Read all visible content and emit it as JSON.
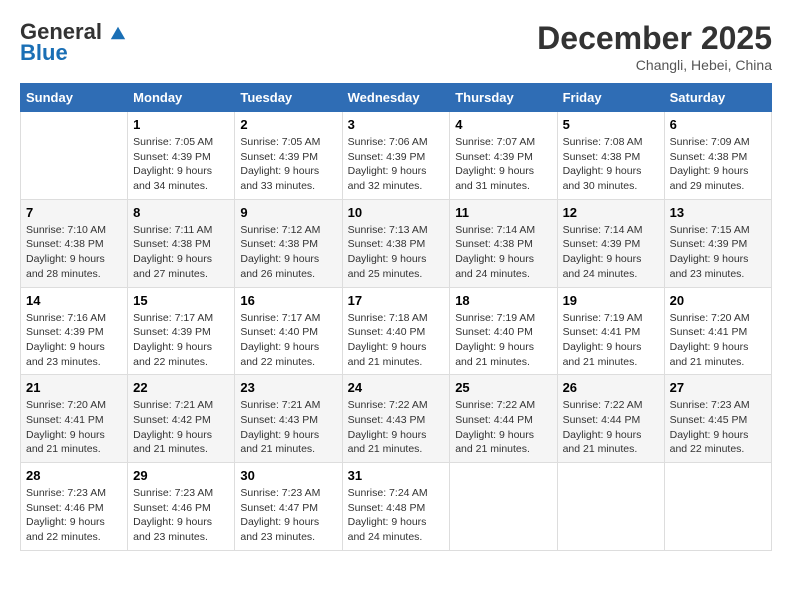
{
  "header": {
    "logo_line1": "General",
    "logo_line2": "Blue",
    "month": "December 2025",
    "location": "Changli, Hebei, China"
  },
  "columns": [
    "Sunday",
    "Monday",
    "Tuesday",
    "Wednesday",
    "Thursday",
    "Friday",
    "Saturday"
  ],
  "weeks": [
    [
      {
        "day": "",
        "info": ""
      },
      {
        "day": "1",
        "info": "Sunrise: 7:05 AM\nSunset: 4:39 PM\nDaylight: 9 hours\nand 34 minutes."
      },
      {
        "day": "2",
        "info": "Sunrise: 7:05 AM\nSunset: 4:39 PM\nDaylight: 9 hours\nand 33 minutes."
      },
      {
        "day": "3",
        "info": "Sunrise: 7:06 AM\nSunset: 4:39 PM\nDaylight: 9 hours\nand 32 minutes."
      },
      {
        "day": "4",
        "info": "Sunrise: 7:07 AM\nSunset: 4:39 PM\nDaylight: 9 hours\nand 31 minutes."
      },
      {
        "day": "5",
        "info": "Sunrise: 7:08 AM\nSunset: 4:38 PM\nDaylight: 9 hours\nand 30 minutes."
      },
      {
        "day": "6",
        "info": "Sunrise: 7:09 AM\nSunset: 4:38 PM\nDaylight: 9 hours\nand 29 minutes."
      }
    ],
    [
      {
        "day": "7",
        "info": "Sunrise: 7:10 AM\nSunset: 4:38 PM\nDaylight: 9 hours\nand 28 minutes."
      },
      {
        "day": "8",
        "info": "Sunrise: 7:11 AM\nSunset: 4:38 PM\nDaylight: 9 hours\nand 27 minutes."
      },
      {
        "day": "9",
        "info": "Sunrise: 7:12 AM\nSunset: 4:38 PM\nDaylight: 9 hours\nand 26 minutes."
      },
      {
        "day": "10",
        "info": "Sunrise: 7:13 AM\nSunset: 4:38 PM\nDaylight: 9 hours\nand 25 minutes."
      },
      {
        "day": "11",
        "info": "Sunrise: 7:14 AM\nSunset: 4:38 PM\nDaylight: 9 hours\nand 24 minutes."
      },
      {
        "day": "12",
        "info": "Sunrise: 7:14 AM\nSunset: 4:39 PM\nDaylight: 9 hours\nand 24 minutes."
      },
      {
        "day": "13",
        "info": "Sunrise: 7:15 AM\nSunset: 4:39 PM\nDaylight: 9 hours\nand 23 minutes."
      }
    ],
    [
      {
        "day": "14",
        "info": "Sunrise: 7:16 AM\nSunset: 4:39 PM\nDaylight: 9 hours\nand 23 minutes."
      },
      {
        "day": "15",
        "info": "Sunrise: 7:17 AM\nSunset: 4:39 PM\nDaylight: 9 hours\nand 22 minutes."
      },
      {
        "day": "16",
        "info": "Sunrise: 7:17 AM\nSunset: 4:40 PM\nDaylight: 9 hours\nand 22 minutes."
      },
      {
        "day": "17",
        "info": "Sunrise: 7:18 AM\nSunset: 4:40 PM\nDaylight: 9 hours\nand 21 minutes."
      },
      {
        "day": "18",
        "info": "Sunrise: 7:19 AM\nSunset: 4:40 PM\nDaylight: 9 hours\nand 21 minutes."
      },
      {
        "day": "19",
        "info": "Sunrise: 7:19 AM\nSunset: 4:41 PM\nDaylight: 9 hours\nand 21 minutes."
      },
      {
        "day": "20",
        "info": "Sunrise: 7:20 AM\nSunset: 4:41 PM\nDaylight: 9 hours\nand 21 minutes."
      }
    ],
    [
      {
        "day": "21",
        "info": "Sunrise: 7:20 AM\nSunset: 4:41 PM\nDaylight: 9 hours\nand 21 minutes."
      },
      {
        "day": "22",
        "info": "Sunrise: 7:21 AM\nSunset: 4:42 PM\nDaylight: 9 hours\nand 21 minutes."
      },
      {
        "day": "23",
        "info": "Sunrise: 7:21 AM\nSunset: 4:43 PM\nDaylight: 9 hours\nand 21 minutes."
      },
      {
        "day": "24",
        "info": "Sunrise: 7:22 AM\nSunset: 4:43 PM\nDaylight: 9 hours\nand 21 minutes."
      },
      {
        "day": "25",
        "info": "Sunrise: 7:22 AM\nSunset: 4:44 PM\nDaylight: 9 hours\nand 21 minutes."
      },
      {
        "day": "26",
        "info": "Sunrise: 7:22 AM\nSunset: 4:44 PM\nDaylight: 9 hours\nand 21 minutes."
      },
      {
        "day": "27",
        "info": "Sunrise: 7:23 AM\nSunset: 4:45 PM\nDaylight: 9 hours\nand 22 minutes."
      }
    ],
    [
      {
        "day": "28",
        "info": "Sunrise: 7:23 AM\nSunset: 4:46 PM\nDaylight: 9 hours\nand 22 minutes."
      },
      {
        "day": "29",
        "info": "Sunrise: 7:23 AM\nSunset: 4:46 PM\nDaylight: 9 hours\nand 23 minutes."
      },
      {
        "day": "30",
        "info": "Sunrise: 7:23 AM\nSunset: 4:47 PM\nDaylight: 9 hours\nand 23 minutes."
      },
      {
        "day": "31",
        "info": "Sunrise: 7:24 AM\nSunset: 4:48 PM\nDaylight: 9 hours\nand 24 minutes."
      },
      {
        "day": "",
        "info": ""
      },
      {
        "day": "",
        "info": ""
      },
      {
        "day": "",
        "info": ""
      }
    ]
  ]
}
